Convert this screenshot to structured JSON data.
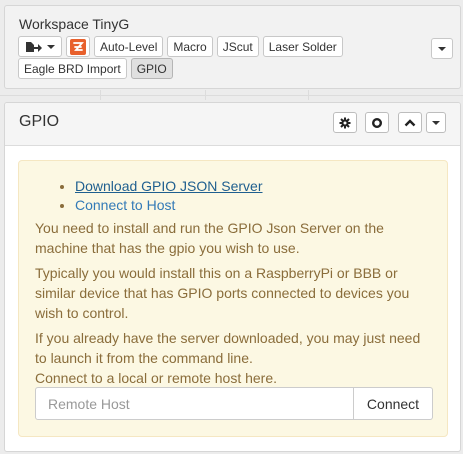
{
  "workspace": {
    "title": "Workspace TinyG",
    "tabs_row1": [
      "Auto-Level",
      "Macro",
      "JScut",
      "Laser Solder"
    ],
    "tabs_row2": [
      "Eagle BRD Import",
      "GPIO"
    ],
    "active_tab": "GPIO",
    "icons": {
      "share": "share-arrow-icon",
      "brand": "zeta-logo-icon",
      "menu": "chevron-down-icon"
    }
  },
  "gpio": {
    "title": "GPIO",
    "header_icons": [
      "gear-icon",
      "circle-icon",
      "chevron-up-icon",
      "chevron-down-icon"
    ],
    "links": {
      "download": "Download GPIO JSON Server",
      "connect": "Connect to Host"
    },
    "paragraphs": {
      "p1": "You need to install and run the GPIO Json Server on the machine that has the gpio you wish to use.",
      "p2": "Typically you would install this on a RaspberryPi or BBB or similar device that has GPIO ports connected to devices you wish to control.",
      "p3": "If you already have the server downloaded, you may just need to launch it from the command line.",
      "p4": "Connect to a local or remote host here."
    },
    "host_input": {
      "placeholder": "Remote Host",
      "value": ""
    },
    "connect_label": "Connect"
  },
  "colors": {
    "alert_bg": "#fcf8e3",
    "alert_text": "#8a6d3b",
    "link": "#337ab7",
    "brand_orange": "#e8602c"
  }
}
